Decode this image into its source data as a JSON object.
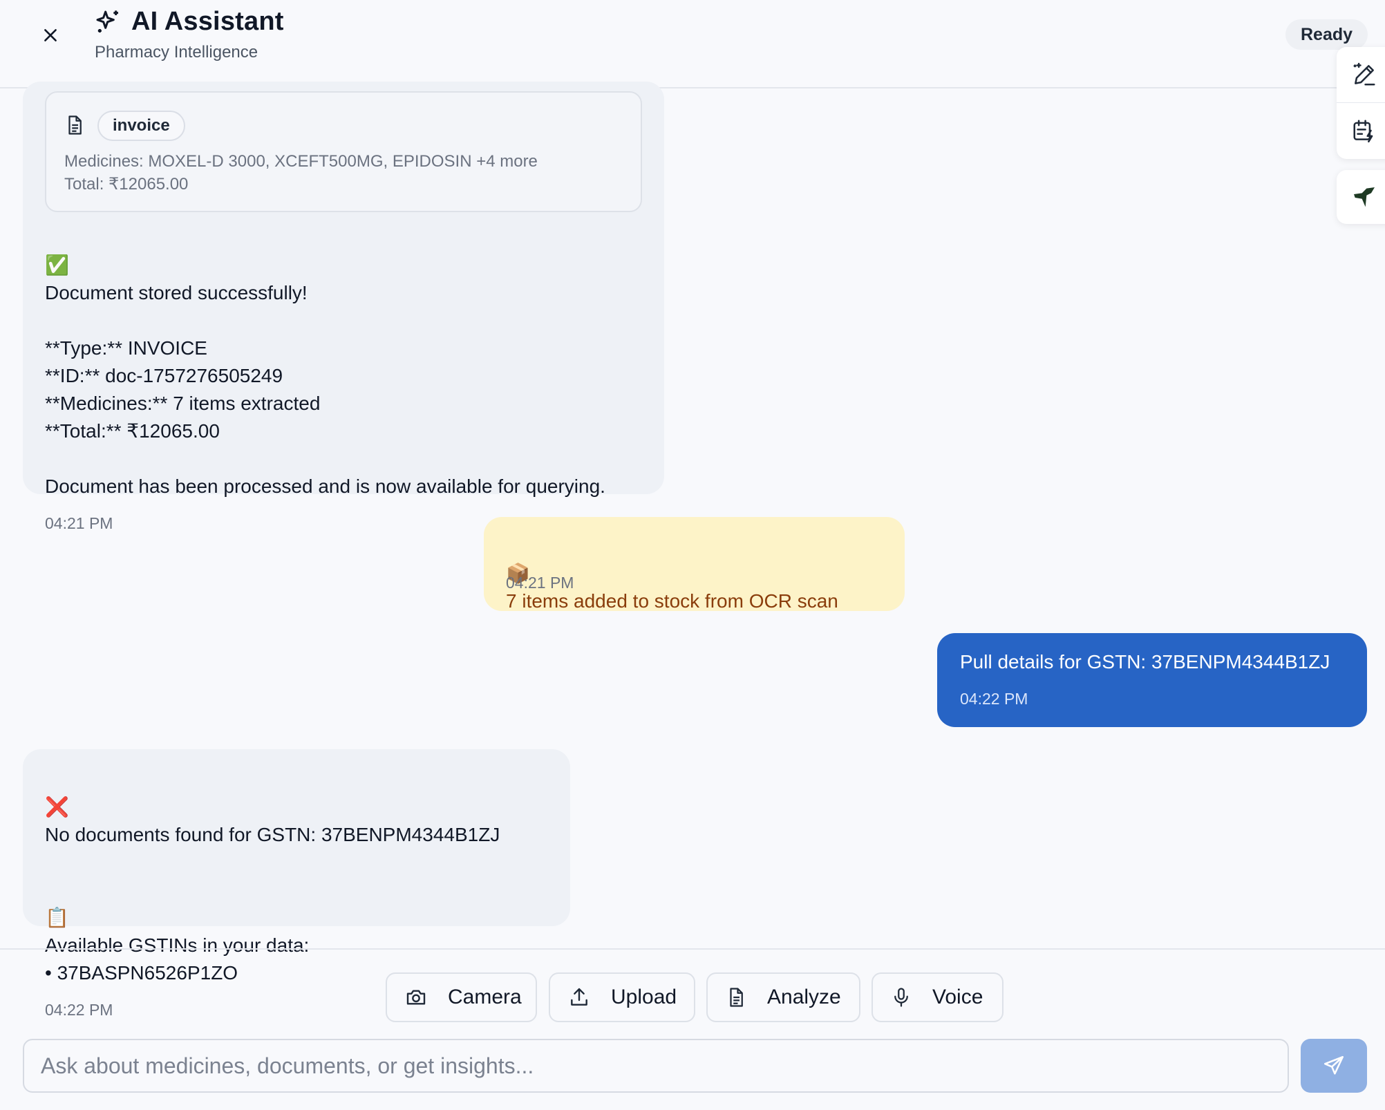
{
  "header": {
    "title": "AI Assistant",
    "subtitle": "Pharmacy Intelligence",
    "status": "Ready"
  },
  "rail": {
    "icons": [
      "pen-sparkle-icon",
      "calendar-bolt-icon",
      "bird-logo-icon"
    ]
  },
  "messages": {
    "doc_result": {
      "card": {
        "tag": "invoice",
        "medicines_line": "Medicines: MOXEL-D 3000, XCEFT500MG, EPIDOSIN +4 more",
        "total_line": "Total: ₹12065.00"
      },
      "check_emoji": "✅",
      "headline": "Document stored successfully!",
      "type_line": "**Type:** INVOICE",
      "id_line": "**ID:** doc-1757276505249",
      "medicines_line": "**Medicines:** 7 items extracted",
      "total_line": "**Total:** ₹12065.00",
      "footer_line": "Document has been processed and is now available for querying.",
      "time": "04:21 PM"
    },
    "stock_notice": {
      "emoji": "📦",
      "text": "7 items added to stock from OCR scan",
      "time": "04:21 PM"
    },
    "user_query": {
      "text": "Pull details for GSTN: 37BENPM4344B1ZJ",
      "time": "04:22 PM"
    },
    "no_docs": {
      "cross_emoji": "❌",
      "headline": "No documents found for GSTN: 37BENPM4344B1ZJ",
      "clipboard_emoji": "📋",
      "available_label": "Available GSTINs in your data:",
      "gstin_item": "• 37BASPN6526P1ZO",
      "time": "04:22 PM"
    }
  },
  "actions": {
    "camera": "Camera",
    "upload": "Upload",
    "analyze": "Analyze",
    "voice": "Voice"
  },
  "composer": {
    "placeholder": "Ask about medicines, documents, or get insights...",
    "value": ""
  },
  "colors": {
    "user_bubble": "#2764c5",
    "system_bubble": "#fdf3c8",
    "ai_bubble": "#eef1f6",
    "send_button": "#8fb0e3"
  }
}
